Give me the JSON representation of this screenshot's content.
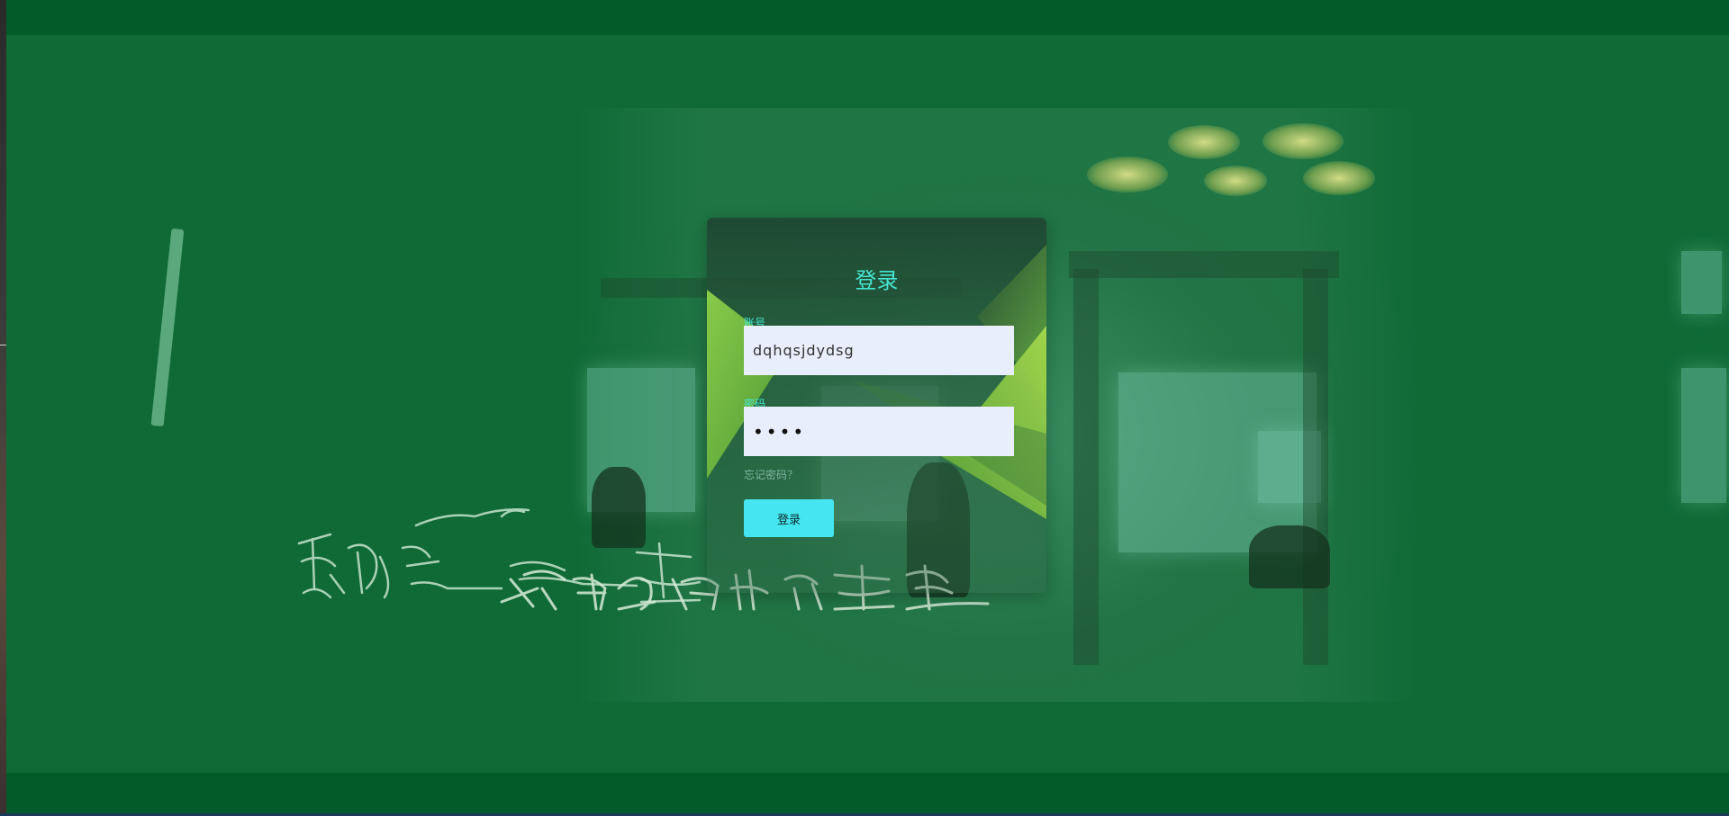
{
  "login": {
    "title": "登录",
    "account_label": "账号",
    "account_value": "dqhqsjdydsg",
    "password_label": "密码",
    "password_value": "••••",
    "forgot_link": "忘记密码？",
    "submit_label": "登录"
  },
  "background": {
    "signature_latin": "Sodagreen",
    "signature_band": "蘇打綠",
    "signature_title": "無與倫比的美麗"
  },
  "colors": {
    "accent": "#45e6d2",
    "button": "#45e6f0",
    "backdrop": "#0f6a36",
    "band": "#025b28",
    "input_bg": "#e8eefb"
  }
}
